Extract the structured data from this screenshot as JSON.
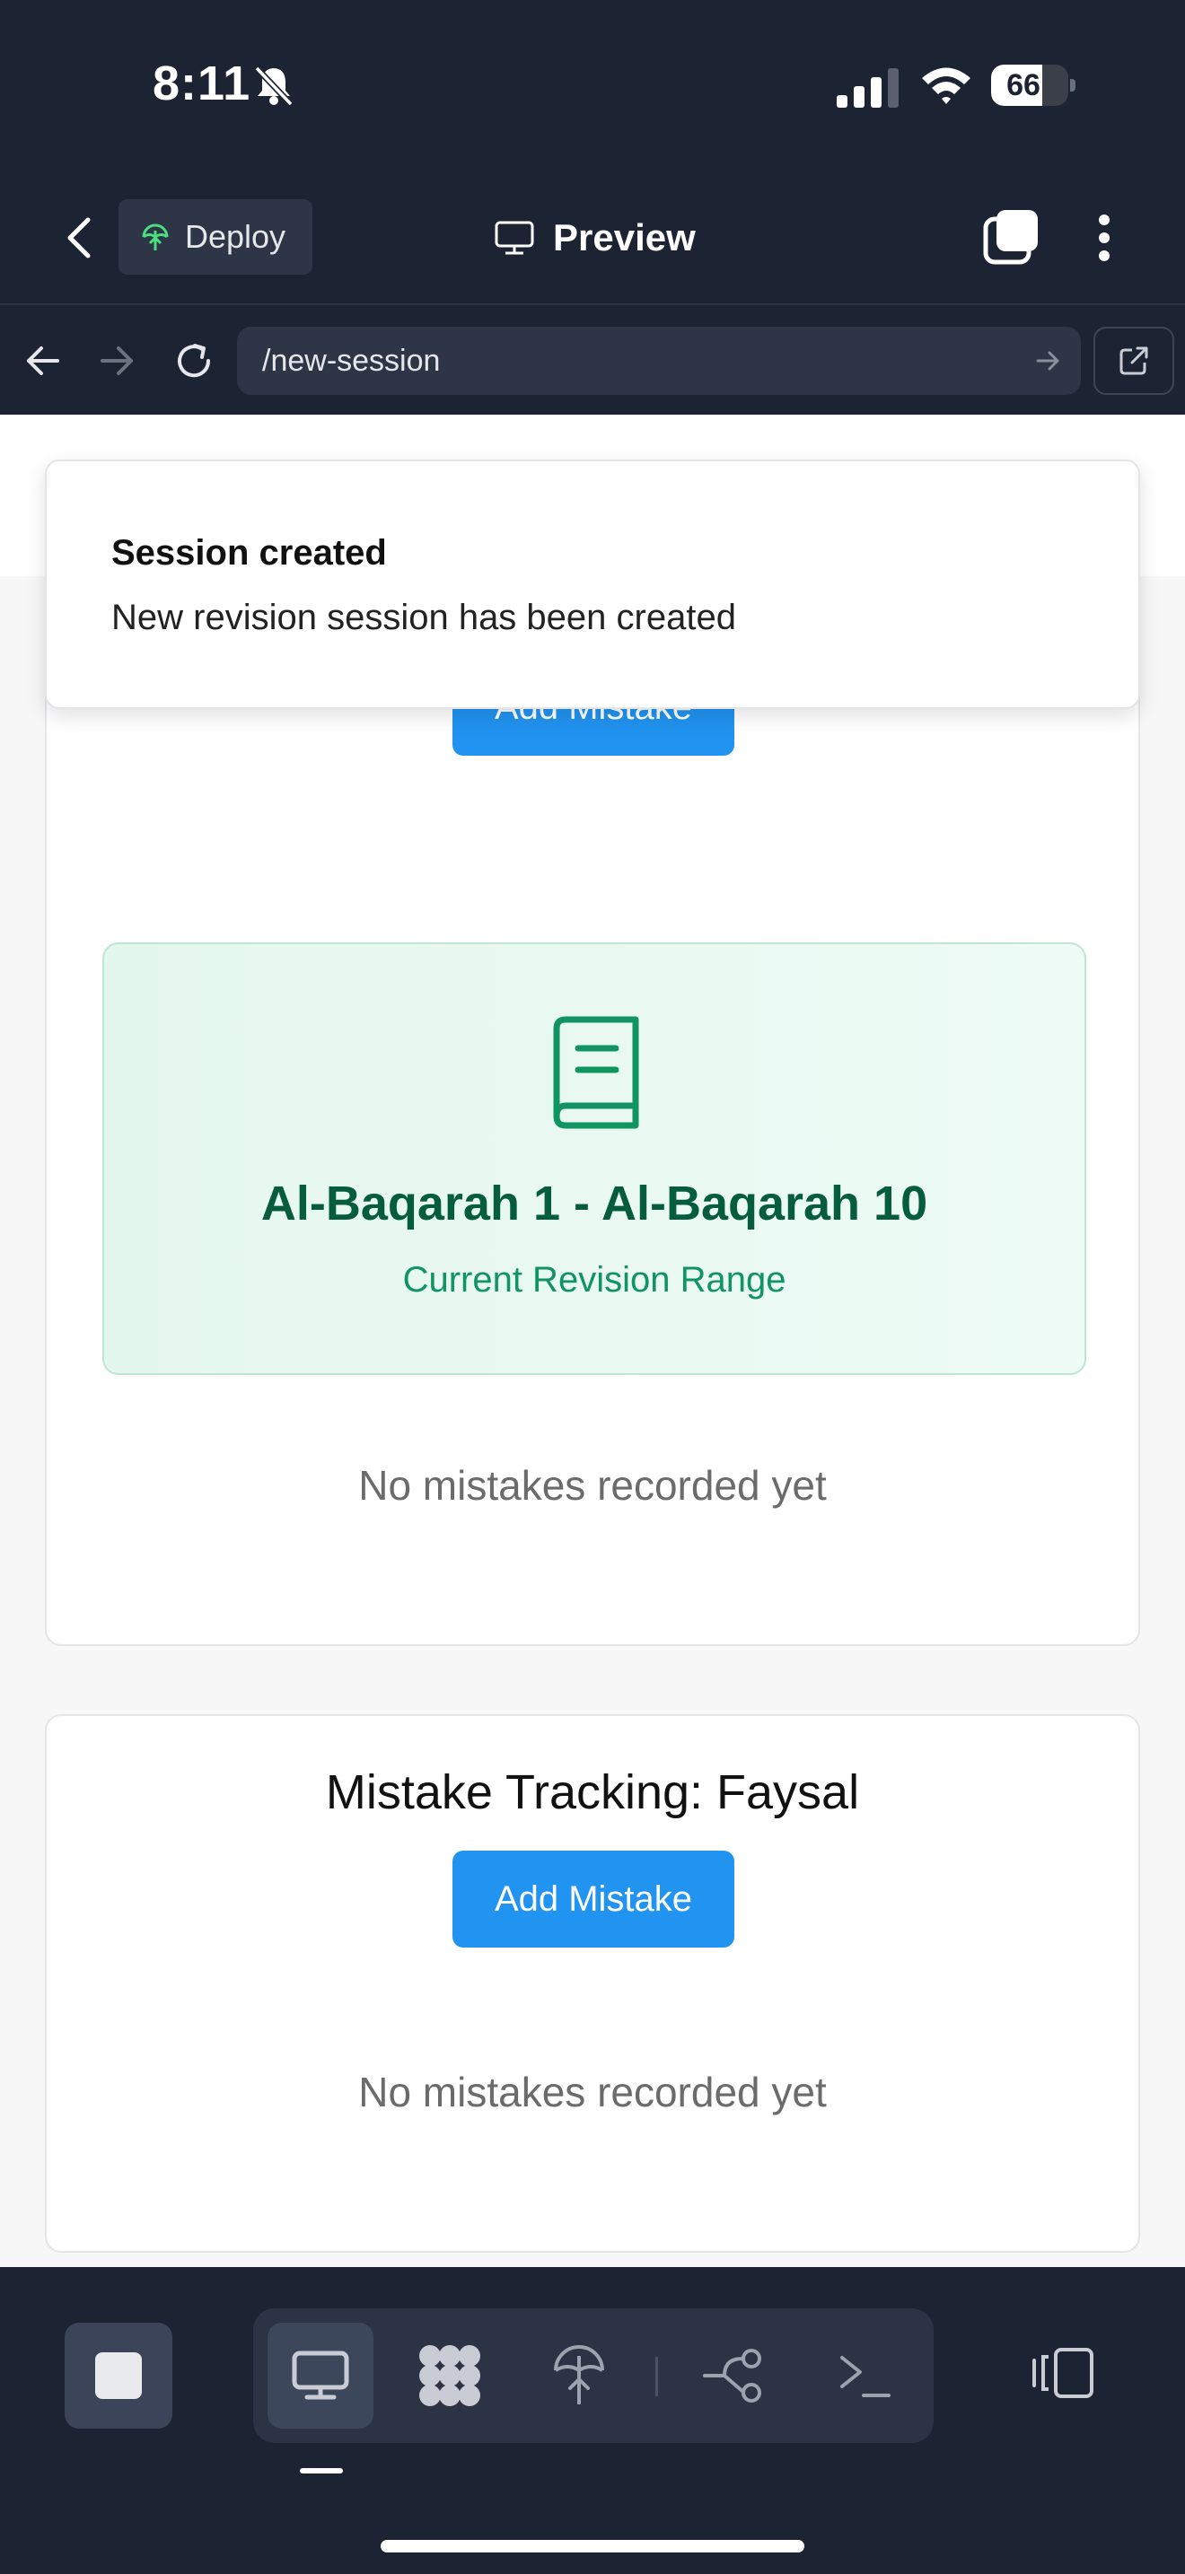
{
  "status_bar": {
    "time": "8:11",
    "battery": "66",
    "battery_level_percent": 66
  },
  "toolbar": {
    "deploy_label": "Deploy",
    "preview_label": "Preview"
  },
  "browser": {
    "url": "/new-session"
  },
  "toast": {
    "title": "Session created",
    "message": "New revision session has been created"
  },
  "card1": {
    "add_button_label": "Add Mistake",
    "range_title": "Al-Baqarah 1 - Al-Baqarah 10",
    "range_subtitle": "Current Revision Range",
    "empty_text": "No mistakes recorded yet"
  },
  "card2": {
    "title": "Mistake Tracking: Faysal",
    "add_button_label": "Add Mistake",
    "empty_text": "No mistakes recorded yet"
  },
  "colors": {
    "primary_button": "#2193f0",
    "range_title": "#065c3f",
    "range_subtitle": "#0f9462",
    "app_chrome": "#1c2333"
  },
  "icons": [
    "bell-slash-icon",
    "signal-icon",
    "wifi-icon",
    "chevron-left-icon",
    "deploy-icon",
    "monitor-icon",
    "tabs-icon",
    "more-vertical-icon",
    "arrow-left-icon",
    "arrow-right-icon",
    "reload-icon",
    "external-link-icon",
    "book-icon",
    "stop-icon",
    "desktop-icon",
    "apps-icon",
    "deploy-tool-icon",
    "git-branch-icon",
    "terminal-icon",
    "panel-toggle-icon"
  ]
}
